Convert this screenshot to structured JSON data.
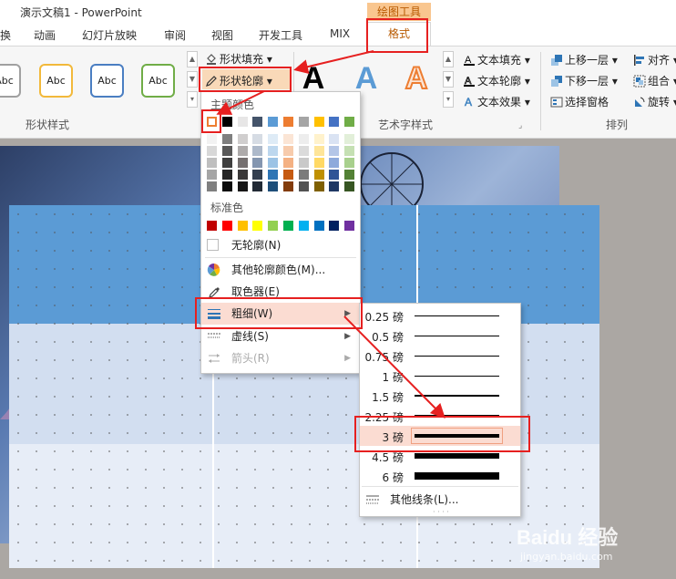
{
  "window": {
    "title": "演示文稿1 - PowerPoint",
    "context_label": "绘图工具"
  },
  "tabs": [
    {
      "label": "换"
    },
    {
      "label": "动画"
    },
    {
      "label": "幻灯片放映"
    },
    {
      "label": "审阅"
    },
    {
      "label": "视图"
    },
    {
      "label": "开发工具"
    },
    {
      "label": "MIX"
    },
    {
      "label": "格式"
    }
  ],
  "ribbon": {
    "shape_styles": {
      "thumbnails": [
        "Abc",
        "Abc",
        "Abc",
        "Abc"
      ],
      "thumb_colors": [
        "#a0a0a0",
        "#f2b93b",
        "#4a7ec2",
        "#70ad47"
      ],
      "group_label": "形状样式"
    },
    "shape_fill": "形状填充",
    "shape_outline": "形状轮廓",
    "wordart": {
      "letters": [
        "A",
        "A",
        "A"
      ],
      "group_label": "艺术字样式"
    },
    "text_fill": "文本填充",
    "text_outline": "文本轮廓",
    "text_effects": "文本效果",
    "arrange": {
      "bring_forward": "上移一层",
      "send_backward": "下移一层",
      "selection_pane": "选择窗格",
      "align": "对齐",
      "group": "组合",
      "rotate": "旋转",
      "group_label": "排列"
    }
  },
  "outline_menu": {
    "theme_colors_label": "主题颜色",
    "theme_top_row": [
      "#ffffff",
      "#000000",
      "#e7e6e6",
      "#44546a",
      "#5b9bd5",
      "#ed7d31",
      "#a5a5a5",
      "#ffc000",
      "#4472c4",
      "#70ad47"
    ],
    "theme_shades": [
      [
        "#f2f2f2",
        "#7f7f7f",
        "#d0cece",
        "#d6dce4",
        "#deebf6",
        "#fbe5d5",
        "#ededed",
        "#fff2cc",
        "#dae3f3",
        "#e2efd9"
      ],
      [
        "#d8d8d8",
        "#595959",
        "#aeabab",
        "#adb9ca",
        "#bdd7ee",
        "#f7cbac",
        "#dbdbdb",
        "#fee599",
        "#b4c6e7",
        "#c5e0b3"
      ],
      [
        "#bfbfbf",
        "#3f3f3f",
        "#757070",
        "#8496b0",
        "#9cc3e5",
        "#f4b183",
        "#c9c9c9",
        "#ffd965",
        "#8eaadb",
        "#a8d08d"
      ],
      [
        "#a5a5a5",
        "#262626",
        "#3a3838",
        "#333f4f",
        "#2e75b5",
        "#c55a11",
        "#7b7b7b",
        "#bf9000",
        "#2f5496",
        "#538135"
      ],
      [
        "#7f7f7f",
        "#0c0c0c",
        "#171616",
        "#222a35",
        "#1e4e79",
        "#833c0b",
        "#525252",
        "#7f6000",
        "#1f3864",
        "#375623"
      ]
    ],
    "standard_colors_label": "标准色",
    "standard_colors": [
      "#c00000",
      "#ff0000",
      "#ffc000",
      "#ffff00",
      "#92d050",
      "#00b050",
      "#00b0f0",
      "#0070c0",
      "#002060",
      "#7030a0"
    ],
    "items": [
      {
        "label": "无轮廓(N)"
      },
      {
        "label": "其他轮廓颜色(M)..."
      },
      {
        "label": "取色器(E)"
      },
      {
        "label": "粗细(W)"
      },
      {
        "label": "虚线(S)"
      },
      {
        "label": "箭头(R)"
      }
    ]
  },
  "weight_menu": {
    "items": [
      {
        "label": "0.25 磅",
        "points": 0.25
      },
      {
        "label": "0.5 磅",
        "points": 0.5
      },
      {
        "label": "0.75 磅",
        "points": 0.75
      },
      {
        "label": "1 磅",
        "points": 1
      },
      {
        "label": "1.5 磅",
        "points": 1.5
      },
      {
        "label": "2.25 磅",
        "points": 2.25
      },
      {
        "label": "3 磅",
        "points": 3
      },
      {
        "label": "4.5 磅",
        "points": 4.5
      },
      {
        "label": "6 磅",
        "points": 6
      }
    ],
    "more_lines": "其他线条(L)..."
  },
  "watermark": {
    "brand": "Baidu 经验",
    "url": "jingyan.baidu.com"
  }
}
